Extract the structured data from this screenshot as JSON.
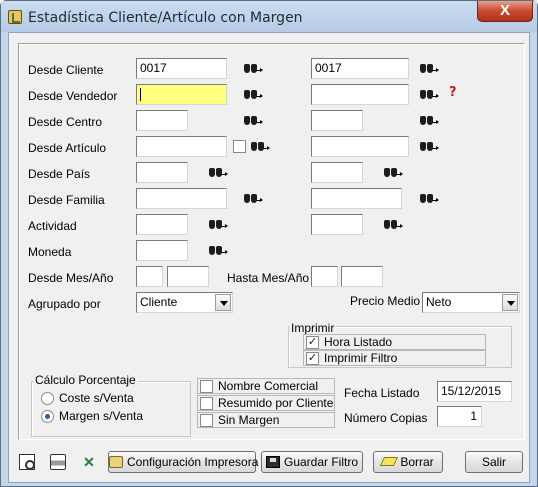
{
  "window": {
    "title": "Estadística Cliente/Artículo con Margen",
    "close_label": "X"
  },
  "form": {
    "desde_cliente": {
      "label": "Desde Cliente",
      "from": "0017",
      "to": "0017"
    },
    "desde_vendedor": {
      "label": "Desde Vendedor",
      "from": "",
      "to": ""
    },
    "desde_centro": {
      "label": "Desde Centro",
      "from": "",
      "to": ""
    },
    "desde_articulo": {
      "label": "Desde Artículo",
      "from": "",
      "to": "",
      "checkbox_checked": false
    },
    "desde_pais": {
      "label": "Desde País",
      "from": "",
      "to": ""
    },
    "desde_familia": {
      "label": "Desde Familia",
      "from": "",
      "to": ""
    },
    "actividad": {
      "label": "Actividad",
      "from": "",
      "to": ""
    },
    "moneda": {
      "label": "Moneda",
      "value": ""
    },
    "desde_mes_anio": {
      "label": "Desde Mes/Año",
      "mes": "",
      "anio": ""
    },
    "hasta_mes_anio": {
      "label": "Hasta Mes/Año",
      "mes": "",
      "anio": ""
    },
    "agrupado_por": {
      "label": "Agrupado por",
      "selected": "Cliente"
    },
    "precio_medio": {
      "label": "Precio Medio",
      "selected": "Neto"
    }
  },
  "imprimir": {
    "title": "Imprimir",
    "options": [
      {
        "label": "Hora Listado",
        "checked": true
      },
      {
        "label": "Imprimir Filtro",
        "checked": true
      }
    ]
  },
  "calculo_porcentaje": {
    "title": "Cálculo Porcentaje",
    "options": [
      {
        "label": "Coste s/Venta",
        "selected": false
      },
      {
        "label": "Margen s/Venta",
        "selected": true
      }
    ]
  },
  "extra_options": [
    {
      "label": "Nombre Comercial",
      "checked": false
    },
    {
      "label": "Resumido por Cliente",
      "checked": false
    },
    {
      "label": "Sin Margen",
      "checked": false
    }
  ],
  "fecha_listado": {
    "label": "Fecha Listado",
    "value": "15/12/2015"
  },
  "numero_copias": {
    "label": "Número Copias",
    "value": "1"
  },
  "toolbar": {
    "icons": [
      "preview-icon",
      "print-icon",
      "excel-icon"
    ],
    "config_label": "Configuración Impresora",
    "save_filter_label": "Guardar Filtro",
    "clear_label": "Borrar",
    "exit_label": "Salir"
  },
  "colors": {
    "title_bar": "#c4d6ea",
    "close_button": "#c74a30",
    "active_field": "#ffff80",
    "dialog_bg": "#f0f0f0"
  }
}
